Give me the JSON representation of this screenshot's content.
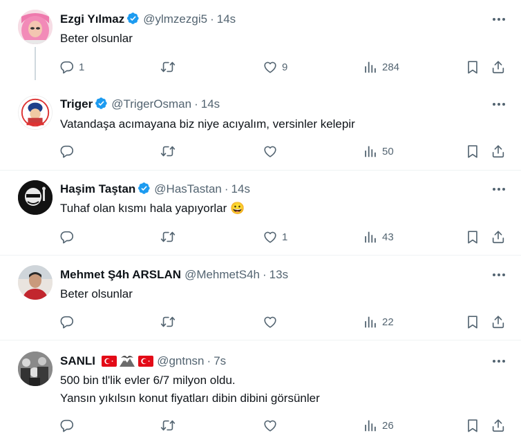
{
  "tweets": [
    {
      "name": "Ezgi Yılmaz",
      "handle": "@ylmzezgi5",
      "time": "14s",
      "text": "Beter olsunlar",
      "replies": "1",
      "retweets": "",
      "likes": "9",
      "views": "284",
      "verified": true
    },
    {
      "name": "Triger",
      "handle": "@TrigerOsman",
      "time": "14s",
      "text": "Vatandaşa acımayana biz niye acıyalım, versinler kelepir",
      "replies": "",
      "retweets": "",
      "likes": "",
      "views": "50",
      "verified": true
    },
    {
      "name": "Haşim Taştan",
      "handle": "@HasTastan",
      "time": "14s",
      "text": "Tuhaf olan kısmı hala yapıyorlar 😀",
      "replies": "",
      "retweets": "",
      "likes": "1",
      "views": "43",
      "verified": true
    },
    {
      "name": "Mehmet Ş4h ARSLAN",
      "handle": "@MehmetS4h",
      "time": "13s",
      "text": "Beter olsunlar",
      "replies": "",
      "retweets": "",
      "likes": "",
      "views": "22",
      "verified": false
    },
    {
      "name": "SANLI",
      "handle": "@gntnsn",
      "time": "7s",
      "text": "500 bin tl'lik evler 6/7 milyon oldu.\nYansın yıkılsın konut fiyatları dibin dibini görsünler",
      "replies": "",
      "retweets": "",
      "likes": "",
      "views": "26",
      "verified": false
    }
  ],
  "separator": "·",
  "colors": {
    "verified": "#1d9bf0",
    "secondary_text": "#536471",
    "primary_text": "#0f1419",
    "divider": "#eff3f4",
    "thread_line": "#cfd9de"
  },
  "icons": [
    "verified-badge-icon",
    "more-icon",
    "reply-icon",
    "retweet-icon",
    "like-icon",
    "views-icon",
    "bookmark-icon",
    "share-icon",
    "turkish-flag-icon",
    "eagle-icon"
  ]
}
